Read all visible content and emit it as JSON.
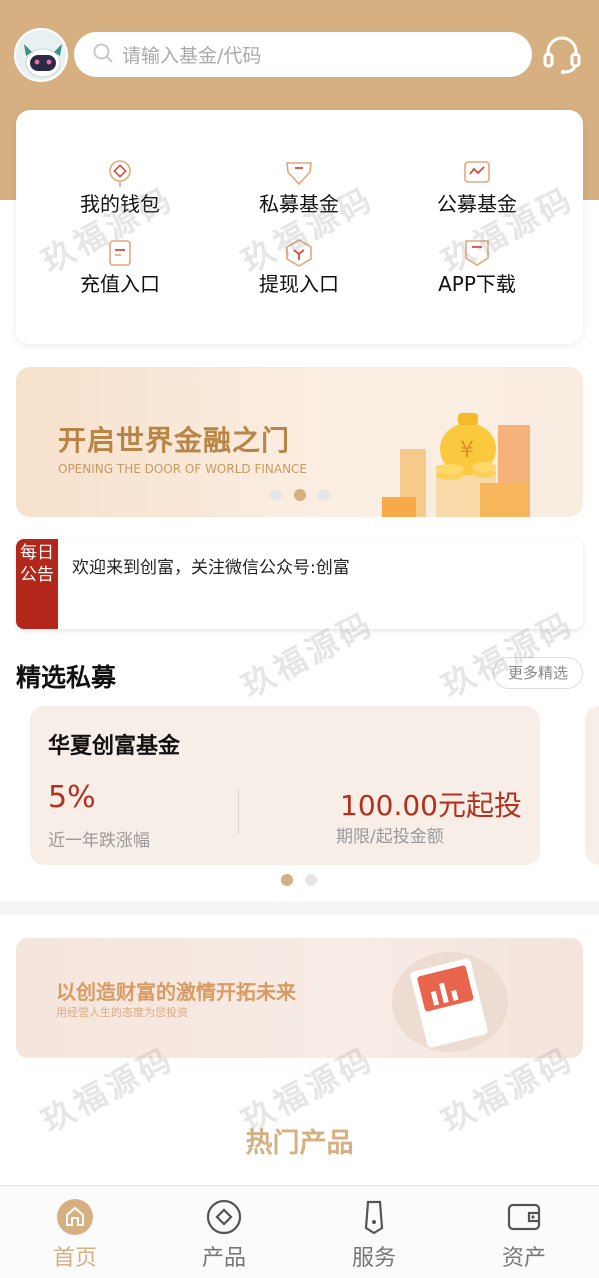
{
  "header": {
    "search_placeholder": "请输入基金/代码",
    "avatar_icon": "robot-avatar-icon",
    "service_icon": "headset-icon"
  },
  "quick_menu": {
    "items": [
      {
        "label": "我的钱包",
        "icon": "wallet-icon"
      },
      {
        "label": "私募基金",
        "icon": "private-fund-icon"
      },
      {
        "label": "公募基金",
        "icon": "public-fund-icon"
      },
      {
        "label": "充值入口",
        "icon": "recharge-icon"
      },
      {
        "label": "提现入口",
        "icon": "withdraw-icon"
      },
      {
        "label": "APP下载",
        "icon": "app-download-icon"
      }
    ]
  },
  "banner_top": {
    "title": "开启世界金融之门",
    "subtitle": "OPENING THE DOOR OF WORLD FINANCE"
  },
  "notice": {
    "tag": "每日公告",
    "text": "欢迎来到创富，关注微信公众号:创富"
  },
  "featured": {
    "title": "精选私募",
    "more_label": "更多精选",
    "fund": {
      "name": "华夏创富基金",
      "rate": "5%",
      "rate_label": "近一年跌涨幅",
      "amount": "100.00元起投",
      "amount_label": "期限/起投金额"
    }
  },
  "banner_mid": {
    "title": "以创造财富的激情开拓未来",
    "subtitle": "用经营人生的态度为您投资"
  },
  "hot": {
    "title": "热门产品"
  },
  "tabbar": {
    "items": [
      {
        "label": "首页",
        "icon": "home-icon",
        "active": true
      },
      {
        "label": "产品",
        "icon": "product-icon",
        "active": false
      },
      {
        "label": "服务",
        "icon": "service-icon",
        "active": false
      },
      {
        "label": "资产",
        "icon": "assets-wallet-icon",
        "active": false
      }
    ]
  },
  "watermark_text": "玖福源码",
  "colors": {
    "brand": "#d6b080",
    "accent_red": "#b3311c",
    "notice_tag": "#b3271a"
  }
}
